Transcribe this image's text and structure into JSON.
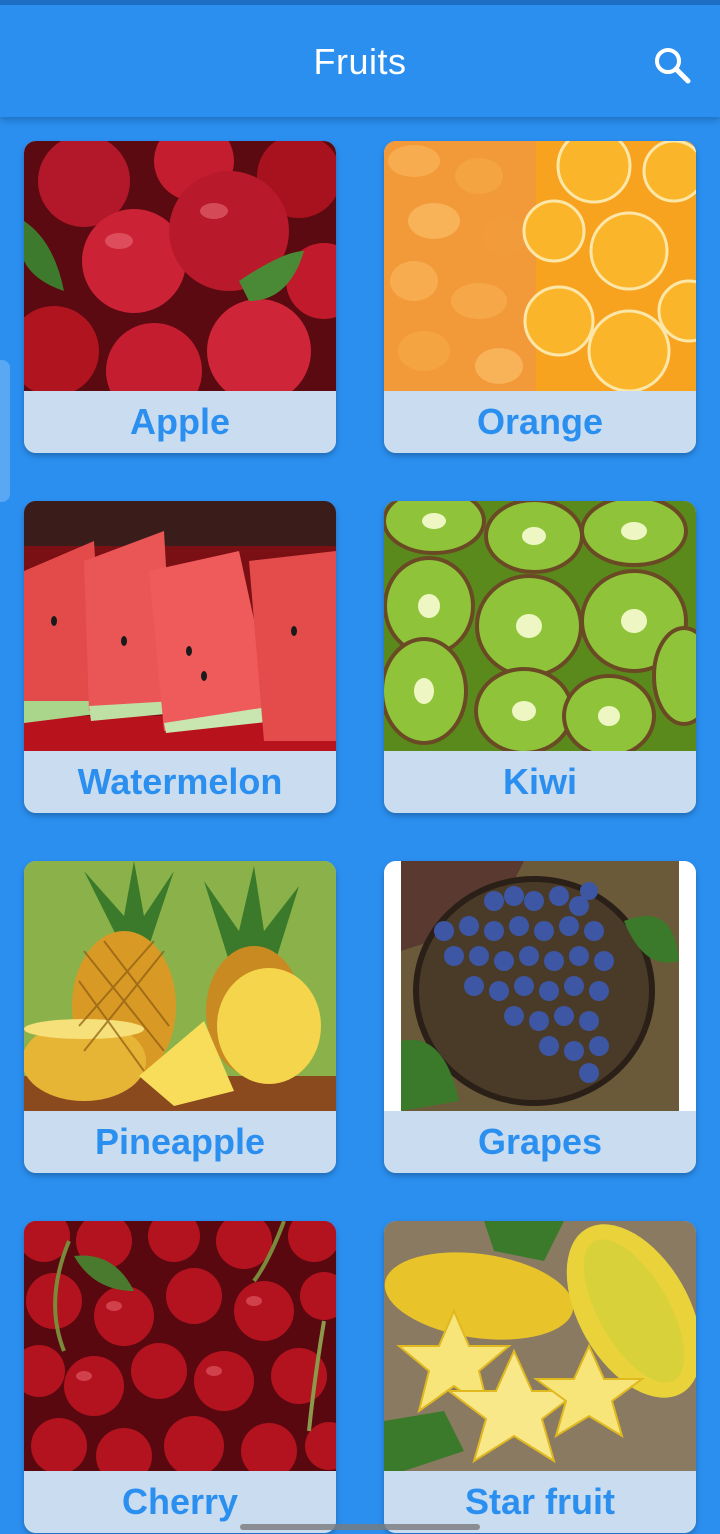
{
  "app": {
    "title": "Fruits"
  },
  "icons": {
    "search": "search-icon"
  },
  "colors": {
    "background": "#2b8ff0",
    "card_label_bg": "#c9dcf0",
    "label_text": "#2b8ff0",
    "title_text": "#ffffff"
  },
  "fruits": [
    {
      "label": "Apple"
    },
    {
      "label": "Orange"
    },
    {
      "label": "Watermelon"
    },
    {
      "label": "Kiwi"
    },
    {
      "label": "Pineapple"
    },
    {
      "label": "Grapes"
    },
    {
      "label": "Cherry"
    },
    {
      "label": "Star fruit"
    }
  ]
}
